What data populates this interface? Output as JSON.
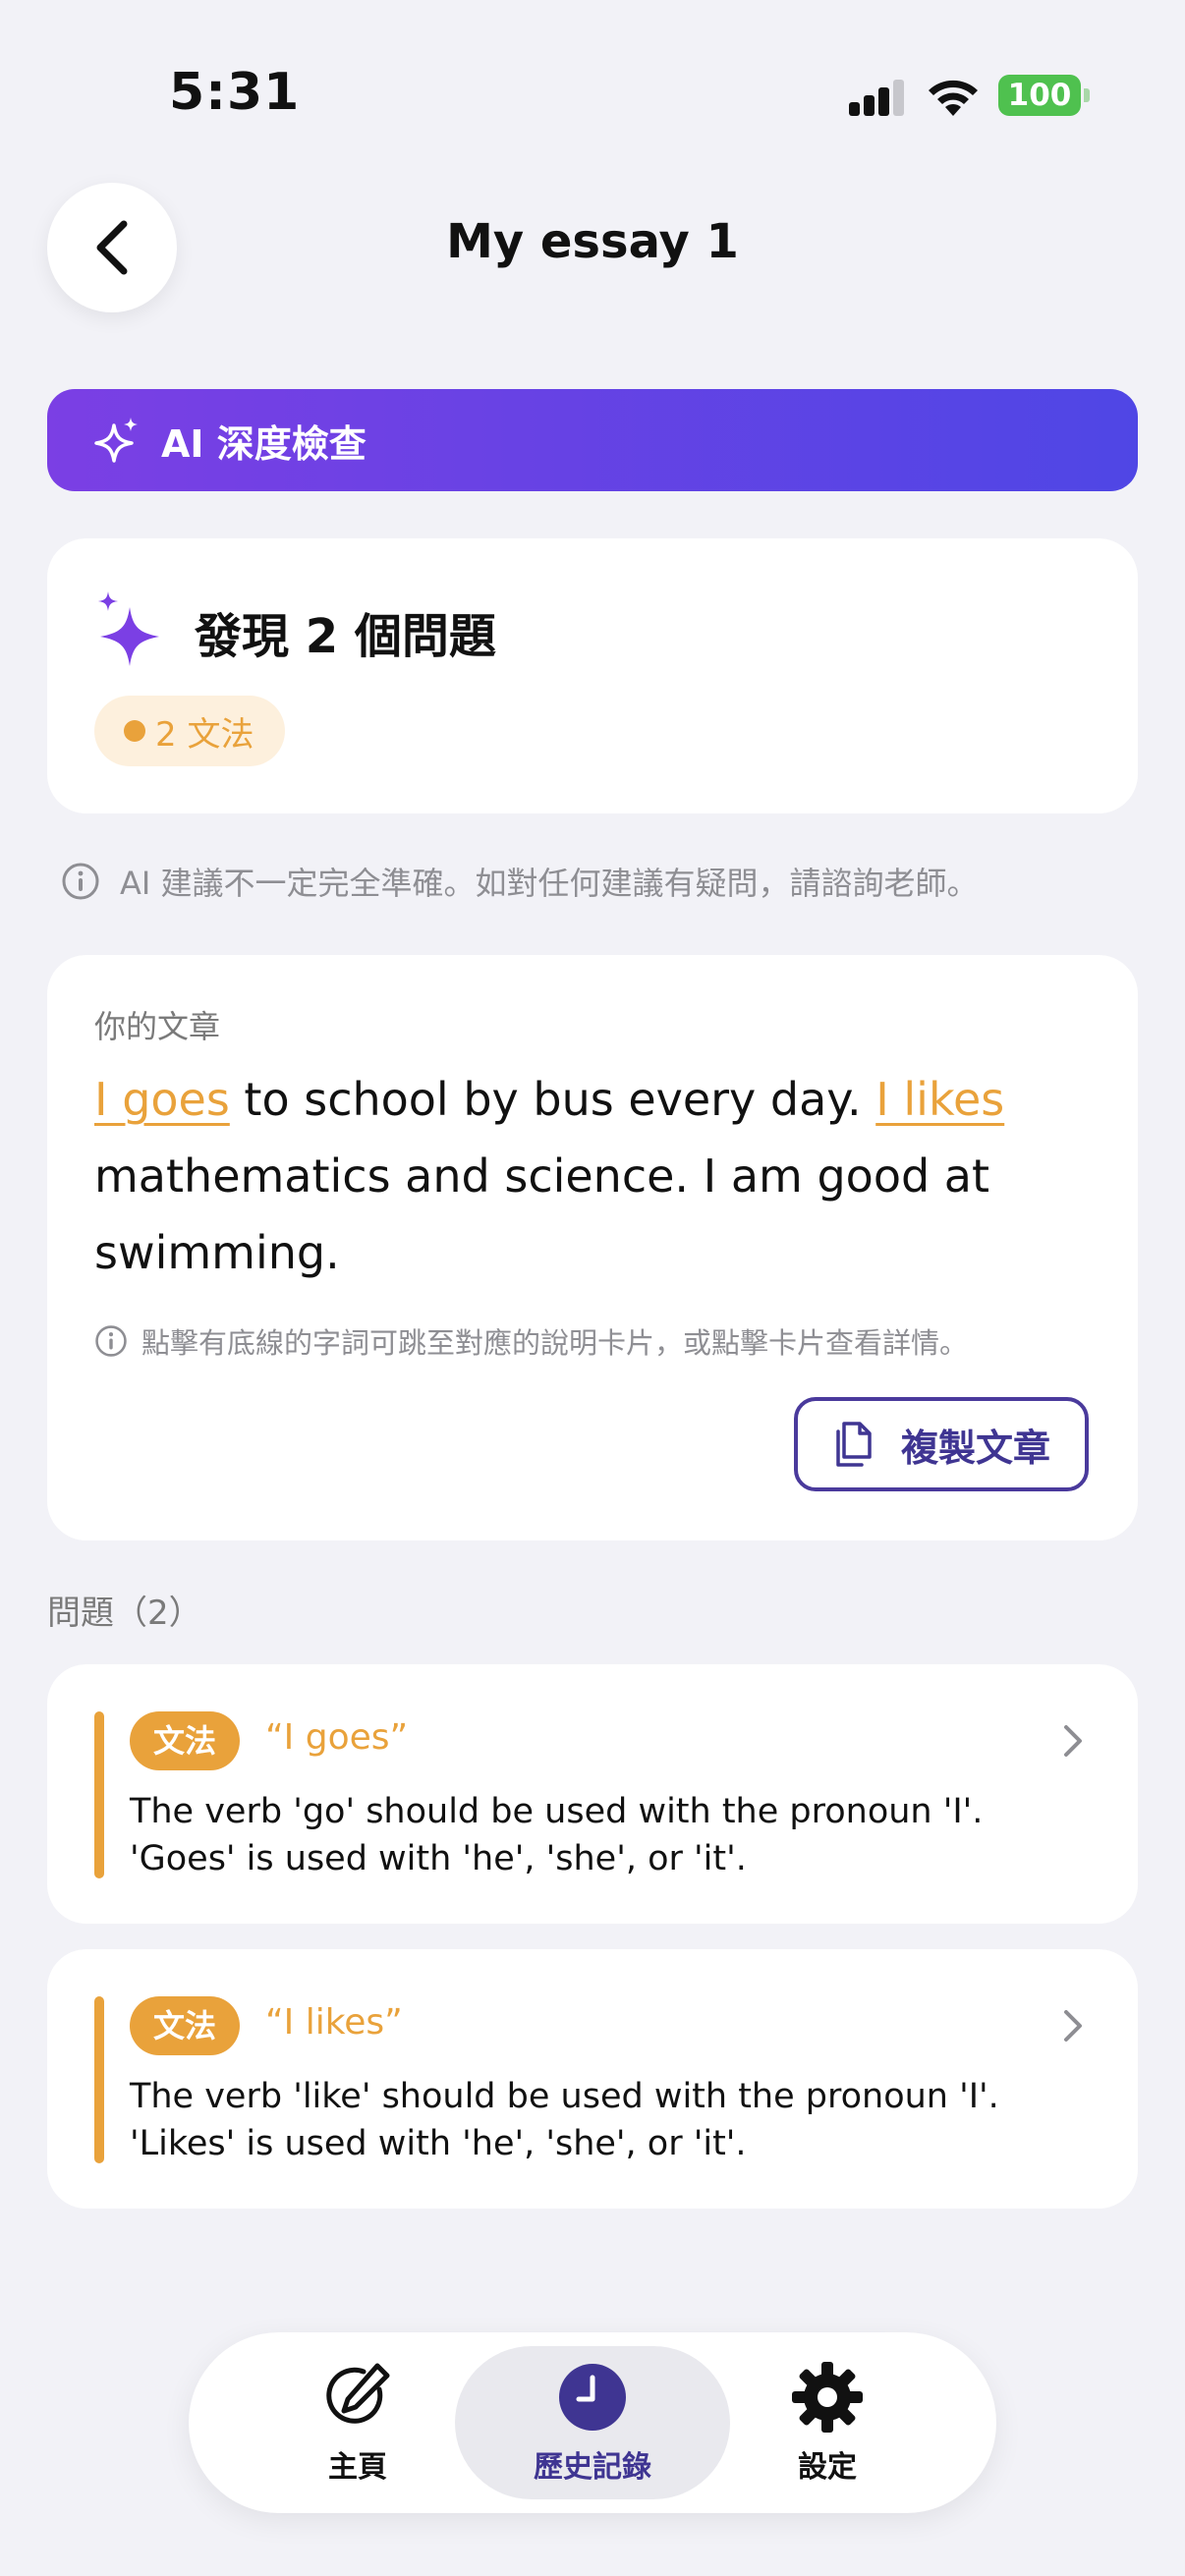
{
  "status_bar": {
    "time": "5:31",
    "battery": "100"
  },
  "header": {
    "title": "My essay 1",
    "back_icon": "chevron-left-icon"
  },
  "ai_banner": {
    "label": "AI 深度檢查",
    "icon": "sparkle-icon"
  },
  "summary": {
    "title": "發現 2 個問題",
    "grammar_badge": "2 文法"
  },
  "disclaimer": "AI 建議不一定完全準確。如對任何建議有疑問，請諮詢老師。",
  "essay": {
    "label": "你的文章",
    "segments": [
      {
        "text": "I goes",
        "highlight": true
      },
      {
        "text": " to school by bus every day. ",
        "highlight": false
      },
      {
        "text": "I likes",
        "highlight": true
      },
      {
        "text": " mathematics and science. I am good at swimming.",
        "highlight": false
      }
    ],
    "hint": "點擊有底線的字詞可跳至對應的說明卡片，或點擊卡片查看詳情。",
    "copy_button": "複製文章"
  },
  "issues": {
    "label": "問題（2）",
    "items": [
      {
        "tag": "文法",
        "quote": "“I goes”",
        "line1": "The verb 'go' should be used with the pronoun 'I'.",
        "line2": "'Goes' is used with 'he', 'she', or 'it'."
      },
      {
        "tag": "文法",
        "quote": "“I likes”",
        "line1": "The verb 'like' should be used with the pronoun 'I'.",
        "line2": "'Likes' is used with 'he', 'she', or 'it'."
      }
    ]
  },
  "nav": {
    "items": [
      {
        "label": "主頁",
        "icon": "edit-pen-icon",
        "active": false
      },
      {
        "label": "歷史記錄",
        "icon": "clock-icon",
        "active": true
      },
      {
        "label": "設定",
        "icon": "gear-icon",
        "active": false
      }
    ]
  },
  "colors": {
    "accent": "#4f46e5",
    "accent_purple": "#7b3fe4",
    "warning": "#e9a23b",
    "nav_active": "#3f3592"
  }
}
